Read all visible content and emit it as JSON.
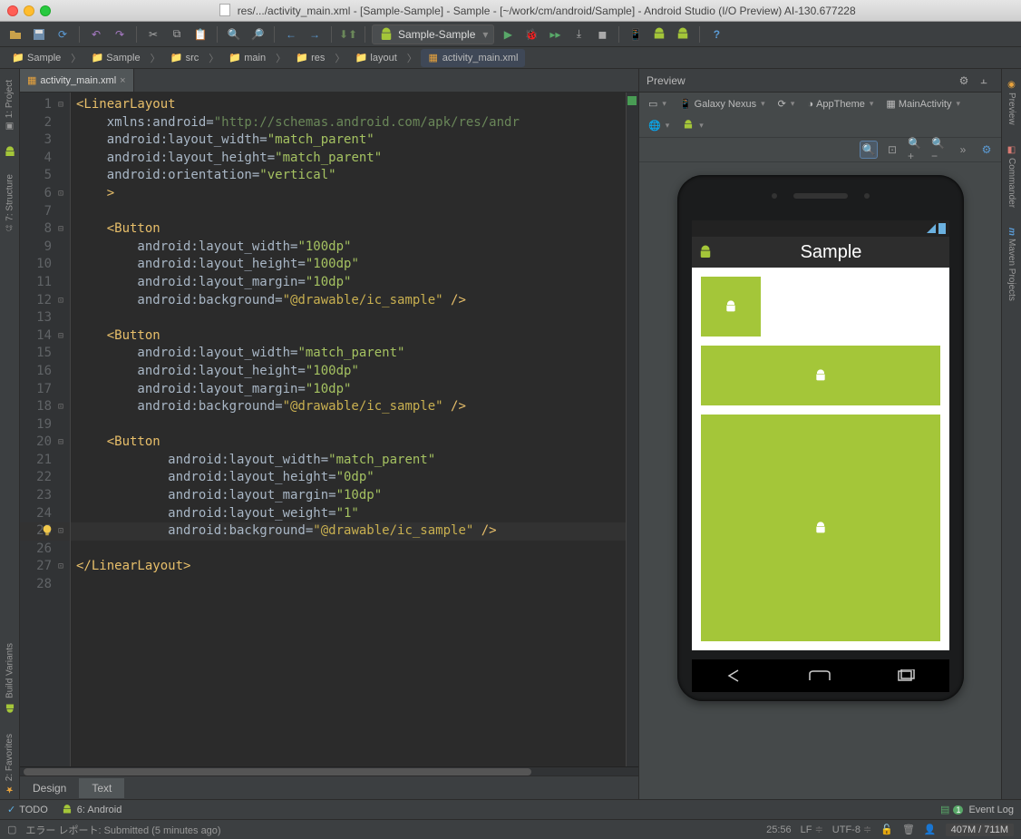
{
  "window": {
    "title": "res/.../activity_main.xml - [Sample-Sample] - Sample - [~/work/cm/android/Sample] - Android Studio (I/O Preview) AI-130.677228"
  },
  "toolbar": {
    "run_config": "Sample-Sample"
  },
  "breadcrumb": [
    {
      "label": "Sample",
      "icon": "project"
    },
    {
      "label": "Sample",
      "icon": "module"
    },
    {
      "label": "src",
      "icon": "folder"
    },
    {
      "label": "main",
      "icon": "folder"
    },
    {
      "label": "res",
      "icon": "folder"
    },
    {
      "label": "layout",
      "icon": "folder"
    },
    {
      "label": "activity_main.xml",
      "icon": "xml"
    }
  ],
  "left_gutter": [
    {
      "label": "1: Project",
      "icon": "project"
    },
    {
      "label": "7: Structure",
      "icon": "structure"
    }
  ],
  "right_gutter": [
    {
      "label": "Preview",
      "icon": "preview"
    },
    {
      "label": "Commander",
      "icon": "commander"
    },
    {
      "label": "Maven Projects",
      "icon": "maven"
    }
  ],
  "bottom_gutter": [
    {
      "label": "Build Variants",
      "icon": "android"
    },
    {
      "label": "2: Favorites",
      "icon": "star"
    }
  ],
  "editor": {
    "tab": "activity_main.xml",
    "designTab": "Design",
    "textTab": "Text",
    "activeTab": "Text",
    "cursorLine": 25,
    "lineCount": 28,
    "code": [
      [
        [
          "t-tag",
          "<LinearLayout"
        ]
      ],
      [
        [
          "t-attr",
          "    xmlns:android="
        ],
        [
          "t-str2",
          "\"http://schemas.android.com/apk/res/andr"
        ]
      ],
      [
        [
          "t-attr",
          "    android:layout_width="
        ],
        [
          "t-str",
          "\"match_parent\""
        ]
      ],
      [
        [
          "t-attr",
          "    android:layout_height="
        ],
        [
          "t-str",
          "\"match_parent\""
        ]
      ],
      [
        [
          "t-attr",
          "    android:orientation="
        ],
        [
          "t-str",
          "\"vertical\""
        ]
      ],
      [
        [
          "t-tag",
          "    >"
        ]
      ],
      [
        [
          "",
          ""
        ]
      ],
      [
        [
          "t-tag",
          "    <Button"
        ]
      ],
      [
        [
          "t-attr",
          "        android:layout_width="
        ],
        [
          "t-str",
          "\"100dp\""
        ]
      ],
      [
        [
          "t-attr",
          "        android:layout_height="
        ],
        [
          "t-str",
          "\"100dp\""
        ]
      ],
      [
        [
          "t-attr",
          "        android:layout_margin="
        ],
        [
          "t-str",
          "\"10dp\""
        ]
      ],
      [
        [
          "t-attr",
          "        android:background="
        ],
        [
          "t-res",
          "\"@drawable/ic_sample\""
        ],
        [
          "t-tag",
          " />"
        ]
      ],
      [
        [
          "",
          ""
        ]
      ],
      [
        [
          "t-tag",
          "    <Button"
        ]
      ],
      [
        [
          "t-attr",
          "        android:layout_width="
        ],
        [
          "t-str",
          "\"match_parent\""
        ]
      ],
      [
        [
          "t-attr",
          "        android:layout_height="
        ],
        [
          "t-str",
          "\"100dp\""
        ]
      ],
      [
        [
          "t-attr",
          "        android:layout_margin="
        ],
        [
          "t-str",
          "\"10dp\""
        ]
      ],
      [
        [
          "t-attr",
          "        android:background="
        ],
        [
          "t-res",
          "\"@drawable/ic_sample\""
        ],
        [
          "t-tag",
          " />"
        ]
      ],
      [
        [
          "",
          ""
        ]
      ],
      [
        [
          "t-tag",
          "    <Button"
        ]
      ],
      [
        [
          "t-attr",
          "            android:layout_width="
        ],
        [
          "t-str",
          "\"match_parent\""
        ]
      ],
      [
        [
          "t-attr",
          "            android:layout_height="
        ],
        [
          "t-str",
          "\"0dp\""
        ]
      ],
      [
        [
          "t-attr",
          "            android:layout_margin="
        ],
        [
          "t-str",
          "\"10dp\""
        ]
      ],
      [
        [
          "t-attr",
          "            android:layout_weight="
        ],
        [
          "t-str",
          "\"1\""
        ]
      ],
      [
        [
          "t-attr",
          "            android:background="
        ],
        [
          "t-res",
          "\"@drawable/ic_sample\""
        ],
        [
          "t-tag",
          " />"
        ]
      ],
      [
        [
          "",
          ""
        ]
      ],
      [
        [
          "t-tag",
          "</LinearLayout>"
        ]
      ],
      [
        [
          "",
          ""
        ]
      ]
    ],
    "folds": {
      "1": "⊟",
      "6": "⊡",
      "8": "⊟",
      "12": "⊡",
      "14": "⊟",
      "18": "⊡",
      "20": "⊟",
      "25": "⊡",
      "27": "⊡"
    }
  },
  "preview": {
    "title": "Preview",
    "device": "Galaxy Nexus",
    "theme": "AppTheme",
    "activity": "MainActivity",
    "appTitle": "Sample"
  },
  "tool_windows": {
    "todo": "TODO",
    "android": "6: Android",
    "eventlog": "Event Log"
  },
  "status": {
    "message": "エラー レポート: Submitted (5 minutes ago)",
    "pos": "25:56",
    "sep": "LF",
    "enc": "UTF-8",
    "mem": "407M / 711M"
  }
}
